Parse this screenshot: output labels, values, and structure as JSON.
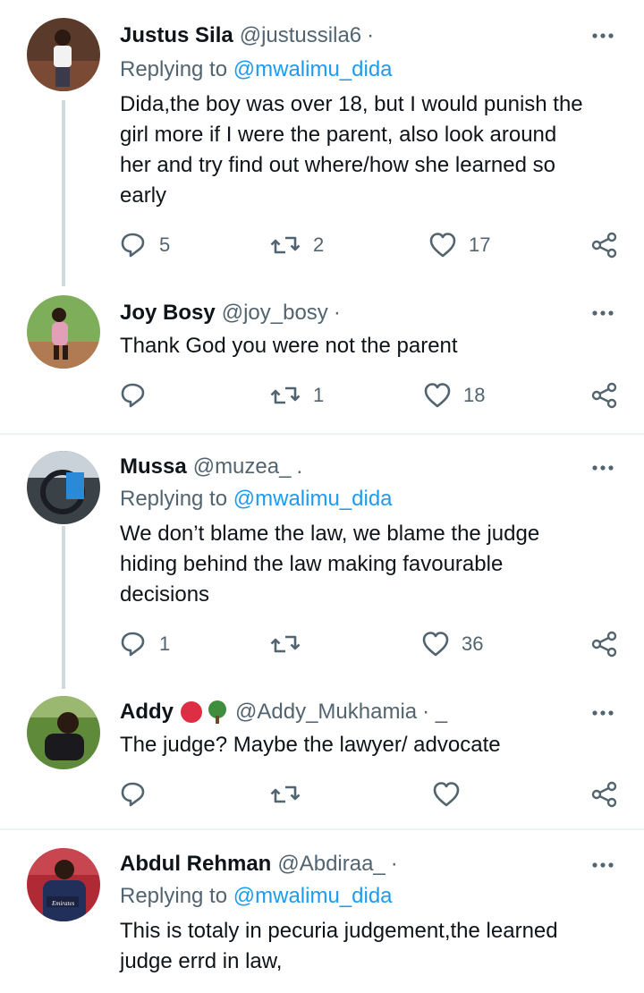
{
  "tweets": [
    {
      "name": "Justus Sila",
      "handle": "@justussila6",
      "separator": "·",
      "replying_prefix": "Replying to",
      "replying_to": "@mwalimu_dida",
      "lines": [
        "Dida,the boy was over 18, but I would punish the",
        "girl more if I were the parent, also look around",
        "her and try find out where/how she learned so",
        "early"
      ],
      "replies": "5",
      "retweets": "2",
      "likes": "17"
    },
    {
      "name": "Joy Bosy",
      "handle": "@joy_bosy",
      "separator": "·",
      "lines": [
        "Thank God you were not the parent"
      ],
      "replies": "",
      "retweets": "1",
      "likes": "18"
    },
    {
      "name": "Mussa",
      "handle": "@muzea_",
      "separator": ".",
      "replying_prefix": "Replying to",
      "replying_to": "@mwalimu_dida",
      "lines": [
        "We don’t blame the law, we blame the judge",
        "hiding behind the law making favourable",
        "decisions"
      ],
      "replies": "1",
      "retweets": "",
      "likes": "36"
    },
    {
      "name": "Addy",
      "name_emojis": [
        "red-circle",
        "tree"
      ],
      "handle": "@Addy_Mukhamia",
      "separator": "· _",
      "lines": [
        "The judge? Maybe the lawyer/ advocate"
      ],
      "replies": "",
      "retweets": "",
      "likes": ""
    },
    {
      "name": "Abdul Rehman",
      "handle": "@Abdiraa_",
      "separator": "·",
      "replying_prefix": "Replying to",
      "replying_to": "@mwalimu_dida",
      "lines": [
        "This is totaly in pecuria judgement,the learned",
        "judge errd in law,"
      ],
      "avatar_text": "Emirates"
    }
  ],
  "icons": [
    "reply-icon",
    "retweet-icon",
    "like-icon",
    "share-icon",
    "more-icon"
  ],
  "colors": {
    "text": "#0f1419",
    "secondary": "#536471",
    "link": "#1d9bf0",
    "thread": "#cfd9de",
    "divider": "#eff3f4"
  }
}
